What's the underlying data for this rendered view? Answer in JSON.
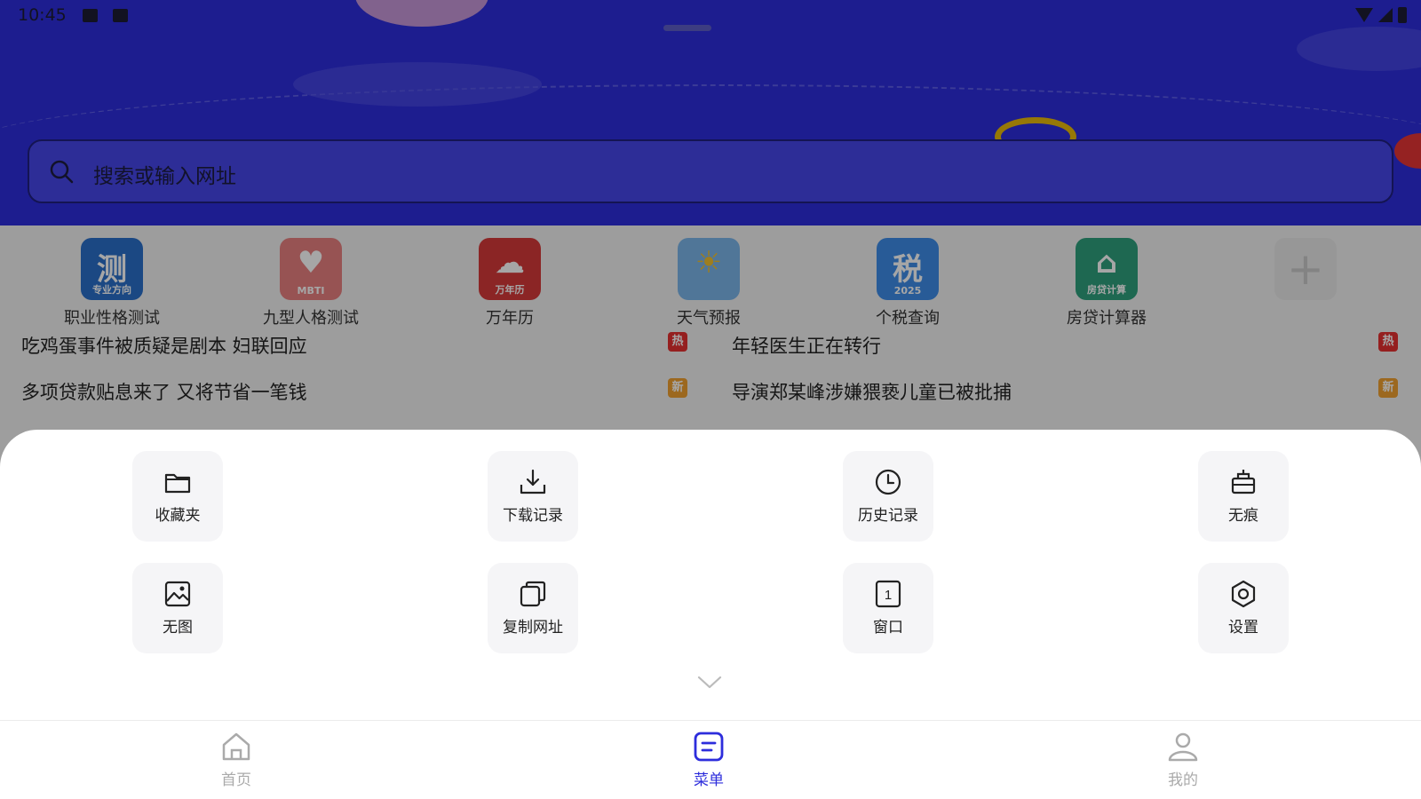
{
  "status_bar": {
    "time": "10:45"
  },
  "search": {
    "placeholder": "搜索或输入网址"
  },
  "shortcuts": [
    {
      "label": "职业性格测试",
      "icon": "ce-test-icon",
      "glyph": "测",
      "sub": "专业方向"
    },
    {
      "label": "九型人格测试",
      "icon": "mbti-icon",
      "glyph": "♥",
      "sub": "MBTI"
    },
    {
      "label": "万年历",
      "icon": "calendar-icon",
      "glyph": "☁",
      "sub": "万年历"
    },
    {
      "label": "天气预报",
      "icon": "weather-icon",
      "glyph": "☀",
      "sub": ""
    },
    {
      "label": "个税查询",
      "icon": "tax-icon",
      "glyph": "税",
      "sub": "2025"
    },
    {
      "label": "房贷计算器",
      "icon": "loan-calc-icon",
      "glyph": "⌂",
      "sub": "房贷计算"
    },
    {
      "label": "",
      "icon": "add-icon",
      "glyph": "+",
      "sub": ""
    }
  ],
  "news": [
    {
      "title": "吃鸡蛋事件被质疑是剧本 妇联回应",
      "badge": "热",
      "badge_type": "hot"
    },
    {
      "title": "年轻医生正在转行",
      "badge": "热",
      "badge_type": "hot"
    },
    {
      "title": "多项贷款贴息来了 又将节省一笔钱",
      "badge": "新",
      "badge_type": "new"
    },
    {
      "title": "导演郑某峰涉嫌猥亵儿童已被批捕",
      "badge": "新",
      "badge_type": "new"
    }
  ],
  "menu": [
    {
      "label": "收藏夹",
      "icon": "folder-icon"
    },
    {
      "label": "下载记录",
      "icon": "download-icon"
    },
    {
      "label": "历史记录",
      "icon": "clock-icon"
    },
    {
      "label": "无痕",
      "icon": "incognito-icon"
    },
    {
      "label": "无图",
      "icon": "image-icon"
    },
    {
      "label": "复制网址",
      "icon": "copy-icon"
    },
    {
      "label": "窗口",
      "icon": "window-icon"
    },
    {
      "label": "设置",
      "icon": "settings-icon"
    }
  ],
  "window_count": "1",
  "bottom_nav": [
    {
      "label": "首页",
      "icon": "home-icon",
      "active": false
    },
    {
      "label": "菜单",
      "icon": "menu-icon",
      "active": true
    },
    {
      "label": "我的",
      "icon": "profile-icon",
      "active": false
    }
  ],
  "colors": {
    "accent": "#2d2ddc",
    "hero_bg": "#2d2ddc",
    "hot_badge": "#e53030",
    "new_badge": "#f0a030"
  }
}
